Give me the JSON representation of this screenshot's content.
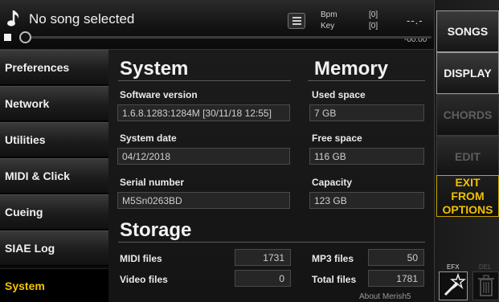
{
  "player": {
    "song_title": "No song selected",
    "bpm_label": "Bpm",
    "bpm_value": "[0]",
    "key_label": "Key",
    "key_value": "[0]",
    "time_display": "--.-",
    "time_remaining": "-00:00",
    "progress_fraction": 0
  },
  "right_buttons": {
    "songs": "SONGS",
    "display": "DISPLAY",
    "chords": "CHORDS",
    "edit": "EDIT",
    "exit_line1": "EXIT FROM",
    "exit_line2": "OPTIONS",
    "efx": "EFX",
    "del": "DEL"
  },
  "nav": {
    "items": [
      {
        "label": "Preferences"
      },
      {
        "label": "Network"
      },
      {
        "label": "Utilities"
      },
      {
        "label": "MIDI & Click"
      },
      {
        "label": "Cueing"
      },
      {
        "label": "SIAE Log"
      },
      {
        "label": "System"
      }
    ],
    "active": "System"
  },
  "system": {
    "title": "System",
    "software_version_label": "Software version",
    "software_version": "1.6.8.1283:1284M [30/11/18 12:55]",
    "system_date_label": "System date",
    "system_date": "04/12/2018",
    "serial_number_label": "Serial number",
    "serial_number": "M5Sn0263BD"
  },
  "memory": {
    "title": "Memory",
    "used_space_label": "Used space",
    "used_space": "7 GB",
    "free_space_label": "Free space",
    "free_space": "116 GB",
    "capacity_label": "Capacity",
    "capacity": "123 GB"
  },
  "storage": {
    "title": "Storage",
    "midi_files_label": "MIDI files",
    "midi_files": "1731",
    "video_files_label": "Video files",
    "video_files": "0",
    "mp3_files_label": "MP3 files",
    "mp3_files": "50",
    "total_files_label": "Total files",
    "total_files": "1781"
  },
  "about_link": "About Merish5",
  "colors": {
    "accent": "#f4c300",
    "background": "#000000",
    "panel": "#181818"
  }
}
